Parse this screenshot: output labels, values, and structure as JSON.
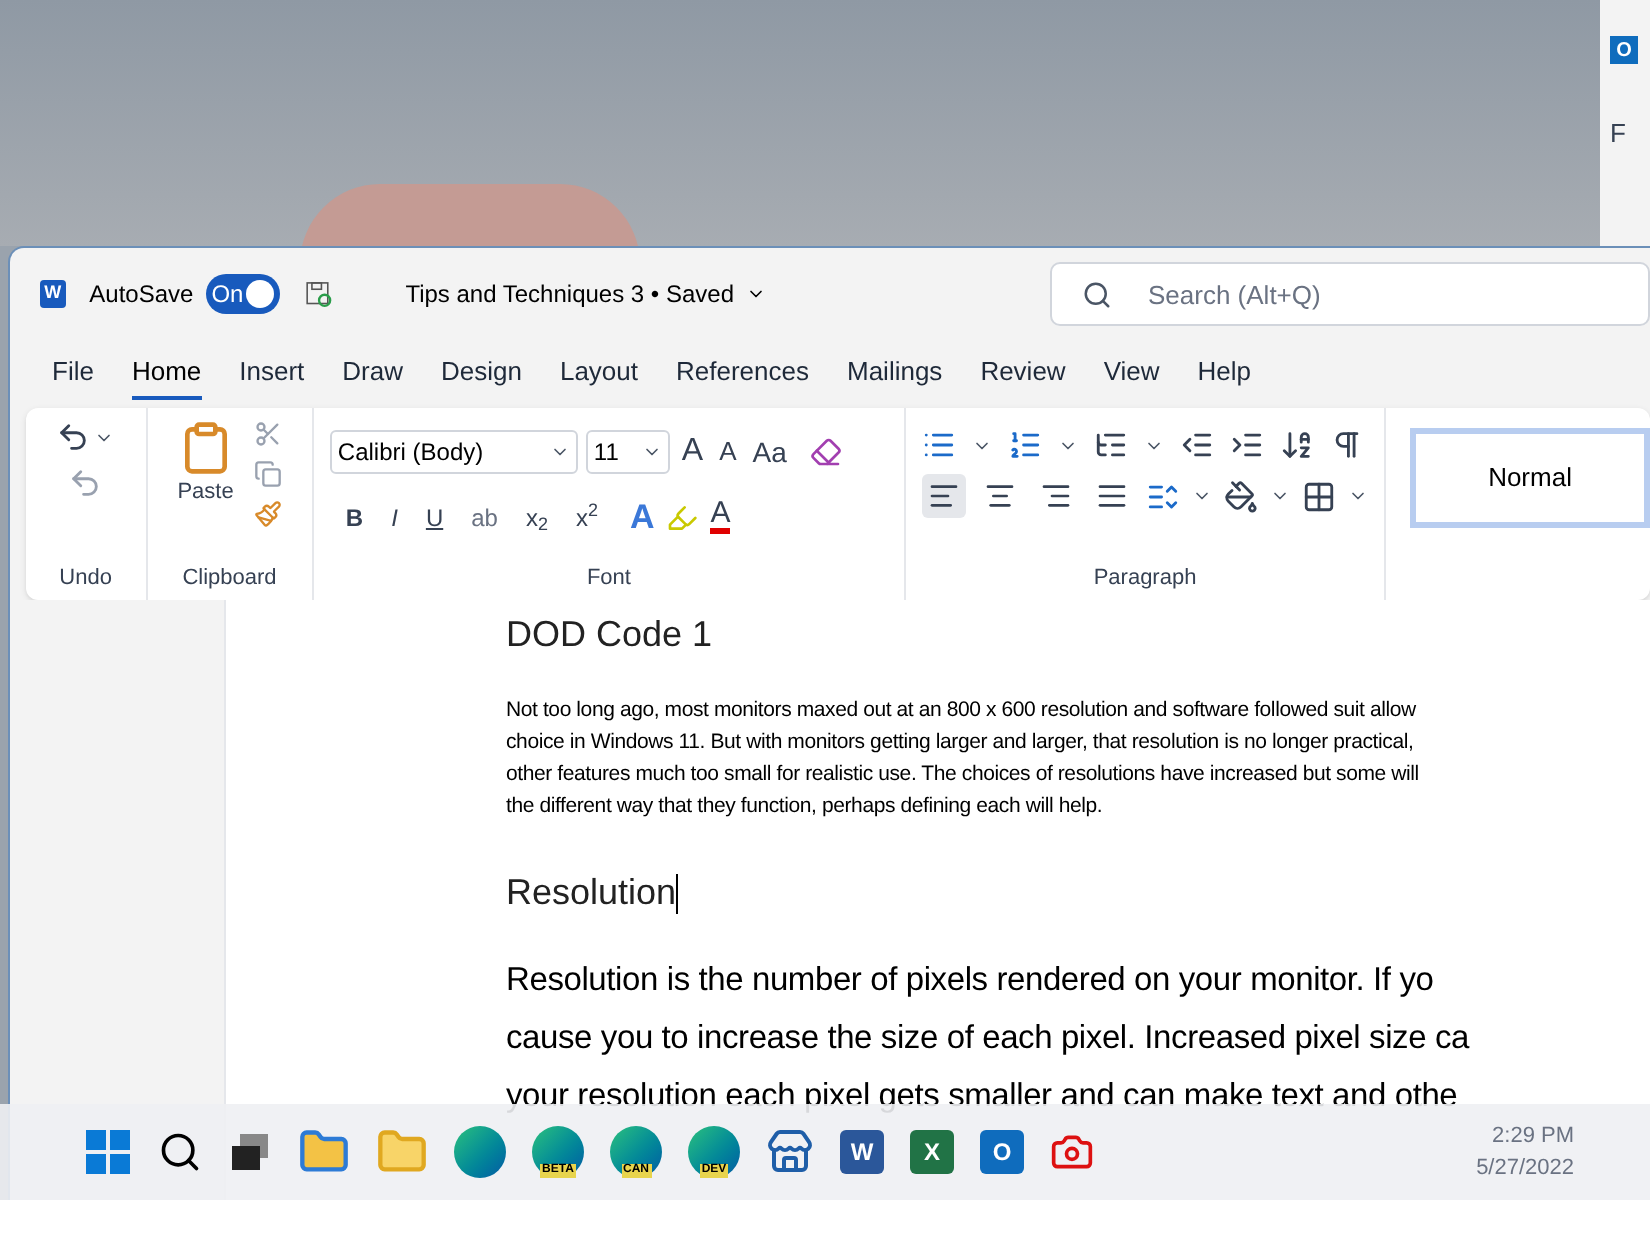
{
  "background_window": {
    "app_icon_letter": "O",
    "text": "F"
  },
  "titlebar": {
    "app_icon_letter": "W",
    "autosave_label": "AutoSave",
    "autosave": {
      "on": true,
      "label": "On"
    },
    "document_title": "Tips and Techniques 3 • Saved",
    "search": {
      "placeholder": "Search (Alt+Q)"
    }
  },
  "tabs": [
    {
      "label": "File",
      "selected": false
    },
    {
      "label": "Home",
      "selected": true
    },
    {
      "label": "Insert",
      "selected": false
    },
    {
      "label": "Draw",
      "selected": false
    },
    {
      "label": "Design",
      "selected": false
    },
    {
      "label": "Layout",
      "selected": false
    },
    {
      "label": "References",
      "selected": false
    },
    {
      "label": "Mailings",
      "selected": false
    },
    {
      "label": "Review",
      "selected": false
    },
    {
      "label": "View",
      "selected": false
    },
    {
      "label": "Help",
      "selected": false
    }
  ],
  "ribbon": {
    "undo": {
      "label": "Undo"
    },
    "clipboard": {
      "paste_label": "Paste",
      "label": "Clipboard"
    },
    "font": {
      "font_name": "Calibri (Body)",
      "font_size": "11",
      "grow_label": "A",
      "shrink_label": "A",
      "case_label": "Aa",
      "format_buttons": [
        {
          "kind": "bold",
          "text": "B"
        },
        {
          "kind": "italic",
          "text": "I"
        },
        {
          "kind": "underline",
          "text": "U"
        },
        {
          "kind": "strike",
          "text": "ab"
        },
        {
          "kind": "script",
          "text": "x$_{2}$"
        },
        {
          "kind": "script",
          "text": "x$^{2}$"
        }
      ],
      "effects_label": "A",
      "color_label": "A",
      "label": "Font"
    },
    "paragraph": {
      "alignments": [
        {
          "kind": "left",
          "selected": true
        },
        {
          "kind": "center",
          "selected": false
        },
        {
          "kind": "right",
          "selected": false
        },
        {
          "kind": "justify",
          "selected": false
        }
      ],
      "label": "Paragraph"
    },
    "styles": [
      {
        "label": "Normal",
        "selected": true
      }
    ]
  },
  "document": {
    "blocks": [
      {
        "kind": "heading",
        "lines": [
          "DOD Code 1"
        ]
      },
      {
        "kind": "small",
        "lines": [
          "Not too long ago, most monitors maxed out at an 800 x 600 resolution and software followed suit allow",
          "choice in Windows 11. But with monitors getting larger and larger, that resolution is no longer practical,",
          "other features much too small for realistic use.  The choices of resolutions have increased but some will",
          "the different way that they function, perhaps defining each will help."
        ]
      },
      {
        "kind": "heading",
        "lines": [
          "Resolution"
        ],
        "cursor": true
      },
      {
        "kind": "body",
        "lines": [
          "Resolution is the number of pixels rendered on your monitor. If yo",
          "cause you to increase the size of each pixel. Increased pixel size ca",
          "your resolution each pixel gets smaller and can make text and othe"
        ]
      }
    ]
  },
  "taskbar": {
    "apps": [
      {
        "kind": "start"
      },
      {
        "kind": "search"
      },
      {
        "kind": "taskview"
      },
      {
        "kind": "folder"
      },
      {
        "kind": "explorer"
      },
      {
        "kind": "edge"
      },
      {
        "kind": "edge",
        "badge": "BETA"
      },
      {
        "kind": "edge",
        "badge": "CAN"
      },
      {
        "kind": "edge",
        "badge": "DEV"
      },
      {
        "kind": "store"
      },
      {
        "kind": "letter",
        "letter": "W",
        "color": "#2b579a"
      },
      {
        "kind": "letter",
        "letter": "X",
        "color": "#217346"
      },
      {
        "kind": "letter",
        "letter": "O",
        "color": "#0f6cbd"
      },
      {
        "kind": "camera"
      }
    ],
    "time": "2:29 PM",
    "date": "5/27/2022"
  }
}
